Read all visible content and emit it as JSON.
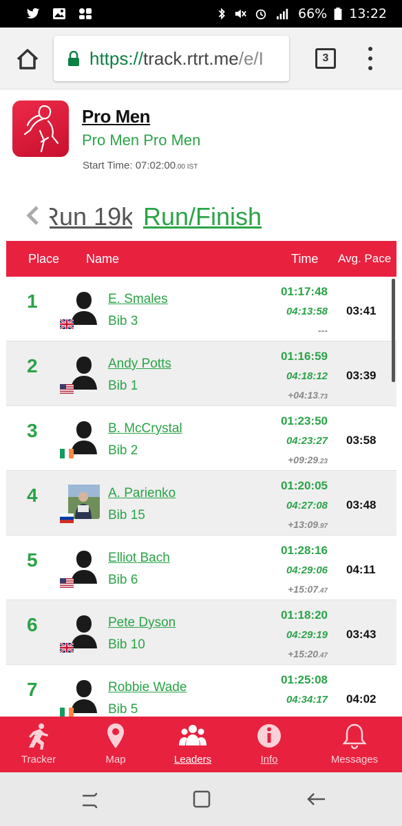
{
  "status_bar": {
    "battery": "66%",
    "time": "13:22",
    "icons": [
      "twitter-icon",
      "image-icon",
      "app-icon",
      "bluetooth-icon",
      "mute-icon",
      "alarm-icon",
      "signal-icon",
      "battery-icon"
    ]
  },
  "browser": {
    "url_scheme": "https://",
    "url_host": "track.rtrt.me",
    "url_path": "/e/I",
    "tab_count": "3"
  },
  "event": {
    "title": "Pro Men",
    "subtitle": "Pro Men Pro Men",
    "start_label": "Start Time: ",
    "start_time": "07:02:00",
    "start_ms": ".00",
    "start_tz": " IST"
  },
  "splits": {
    "previous": "Run 19k",
    "current": "Run/Finish"
  },
  "table": {
    "headers": {
      "place": "Place",
      "name": "Name",
      "time": "Time",
      "pace": "Avg. Pace"
    },
    "rows": [
      {
        "place": "1",
        "name": "E. Smales",
        "bib": "Bib 3",
        "time": "01:17:48",
        "total": "04:13:58",
        "gap": "---",
        "gap_ms": "",
        "pace": "03:41",
        "flag": "GB",
        "photo": false
      },
      {
        "place": "2",
        "name": "Andy Potts",
        "bib": "Bib 1",
        "time": "01:16:59",
        "total": "04:18:12",
        "gap": "+04:13",
        "gap_ms": ".73",
        "pace": "03:39",
        "flag": "US",
        "photo": false
      },
      {
        "place": "3",
        "name": "B. McCrystal",
        "bib": "Bib 2",
        "time": "01:23:50",
        "total": "04:23:27",
        "gap": "+09:29",
        "gap_ms": ".23",
        "pace": "03:58",
        "flag": "IE",
        "photo": false
      },
      {
        "place": "4",
        "name": "A. Parienko",
        "bib": "Bib 15",
        "time": "01:20:05",
        "total": "04:27:08",
        "gap": "+13:09",
        "gap_ms": ".97",
        "pace": "03:48",
        "flag": "RU",
        "photo": true
      },
      {
        "place": "5",
        "name": "Elliot Bach",
        "bib": "Bib 6",
        "time": "01:28:16",
        "total": "04:29:06",
        "gap": "+15:07",
        "gap_ms": ".47",
        "pace": "04:11",
        "flag": "US",
        "photo": false
      },
      {
        "place": "6",
        "name": "Pete Dyson",
        "bib": "Bib 10",
        "time": "01:18:20",
        "total": "04:29:19",
        "gap": "+15:20",
        "gap_ms": ".47",
        "pace": "03:43",
        "flag": "GB",
        "photo": false
      },
      {
        "place": "7",
        "name": "Robbie Wade",
        "bib": "Bib 5",
        "time": "01:25:08",
        "total": "04:34:17",
        "gap": "",
        "gap_ms": "",
        "pace": "04:02",
        "flag": "IE",
        "photo": false
      }
    ]
  },
  "bottom_nav": [
    {
      "label": "Tracker",
      "icon": "runner-icon",
      "active": false
    },
    {
      "label": "Map",
      "icon": "map-pin-icon",
      "active": false
    },
    {
      "label": "Leaders",
      "icon": "group-icon",
      "active": true
    },
    {
      "label": "Info",
      "icon": "info-icon",
      "active": false
    },
    {
      "label": "Messages",
      "icon": "bell-icon",
      "active": false
    }
  ],
  "colors": {
    "accent": "#e8213f",
    "green": "#2aa347"
  }
}
